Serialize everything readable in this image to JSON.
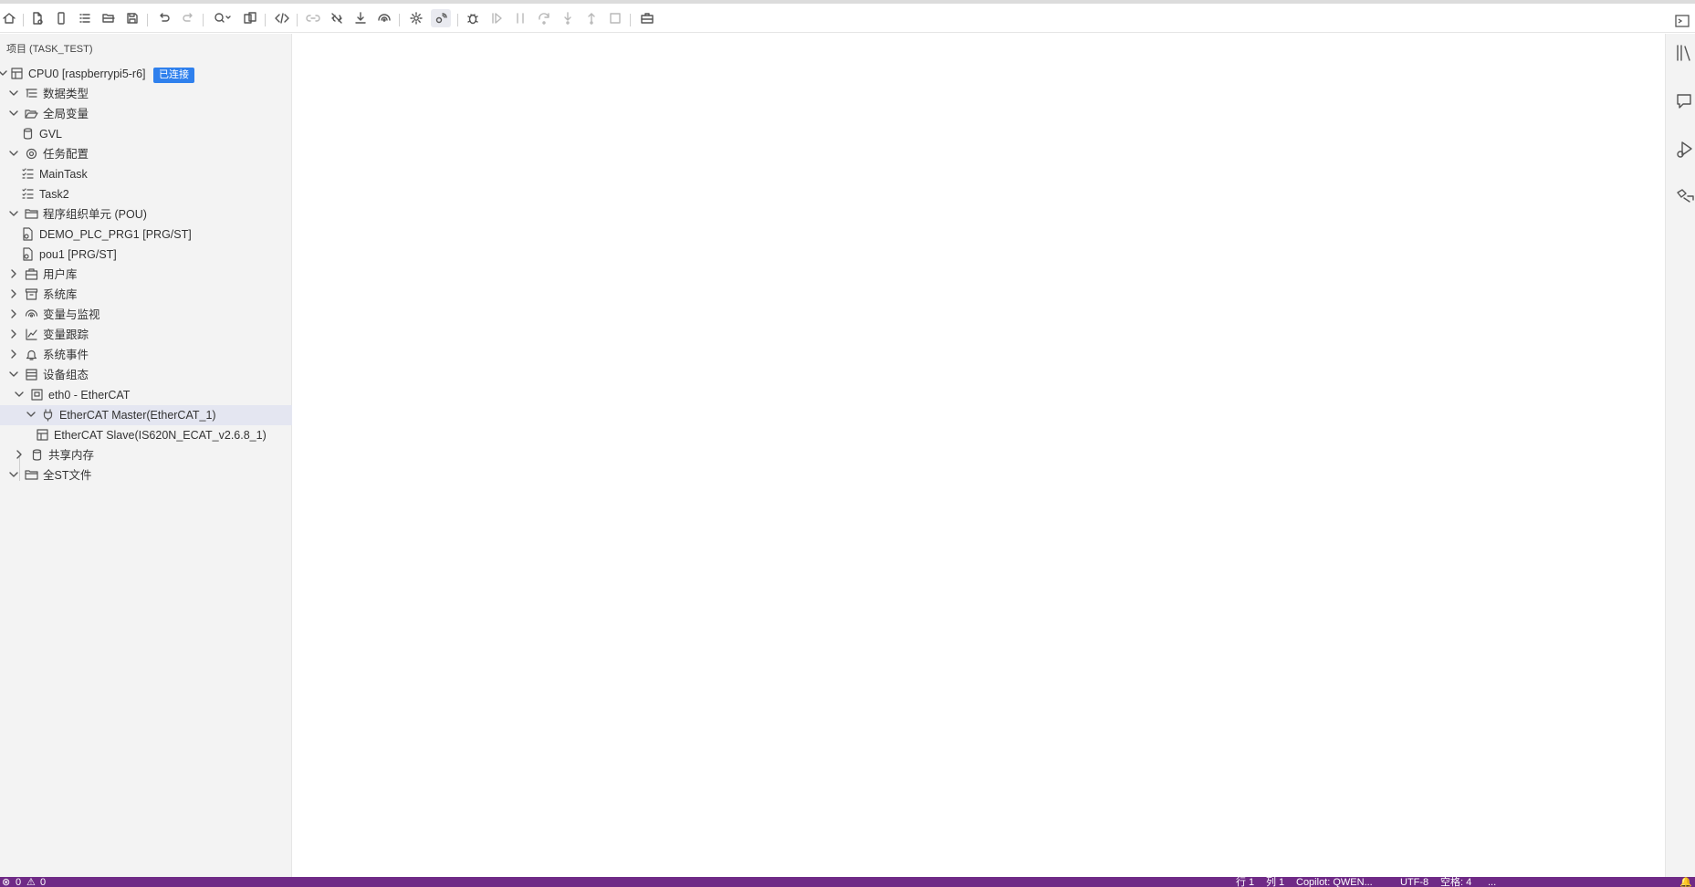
{
  "toolbar": {
    "buttons": [
      "home",
      "new-file",
      "device",
      "list",
      "open-folder",
      "save",
      "undo",
      "redo",
      "search",
      "compare",
      "code",
      "link",
      "unlink",
      "download",
      "monitor",
      "settings",
      "online-settings",
      "debug",
      "step-start",
      "pause",
      "step-over",
      "step-into",
      "step-out",
      "stop",
      "toolbox"
    ]
  },
  "sidebar": {
    "title": "项目 (TASK_TEST)",
    "badge": "已连接",
    "items": [
      {
        "label": "CPU0 [raspberrypi5-r6]"
      },
      {
        "label": "数据类型"
      },
      {
        "label": "全局变量"
      },
      {
        "label": "GVL"
      },
      {
        "label": "任务配置"
      },
      {
        "label": "MainTask"
      },
      {
        "label": "Task2"
      },
      {
        "label": "程序组织单元 (POU)"
      },
      {
        "label": "DEMO_PLC_PRG1 [PRG/ST]"
      },
      {
        "label": "pou1 [PRG/ST]"
      },
      {
        "label": "用户库"
      },
      {
        "label": "系统库"
      },
      {
        "label": "变量与监视"
      },
      {
        "label": "变量跟踪"
      },
      {
        "label": "系统事件"
      },
      {
        "label": "设备组态"
      },
      {
        "label": "eth0 - EtherCAT"
      },
      {
        "label": "EtherCAT Master(EtherCAT_1)"
      },
      {
        "label": "EtherCAT Slave(IS620N_ECAT_v2.6.8_1)"
      },
      {
        "label": "共享内存"
      },
      {
        "label": "全ST文件"
      }
    ]
  },
  "statusbar": {
    "errors": "0",
    "warnings": "0",
    "line": "行 1",
    "column": "列 1",
    "model": "Copilot: QWEN...",
    "encoding": "UTF-8",
    "indent": "空格: 4",
    "extra": "..."
  },
  "colors": {
    "accent": "#2f80ed",
    "statusbar": "#6f2a86",
    "selection": "#e4e6f1"
  }
}
